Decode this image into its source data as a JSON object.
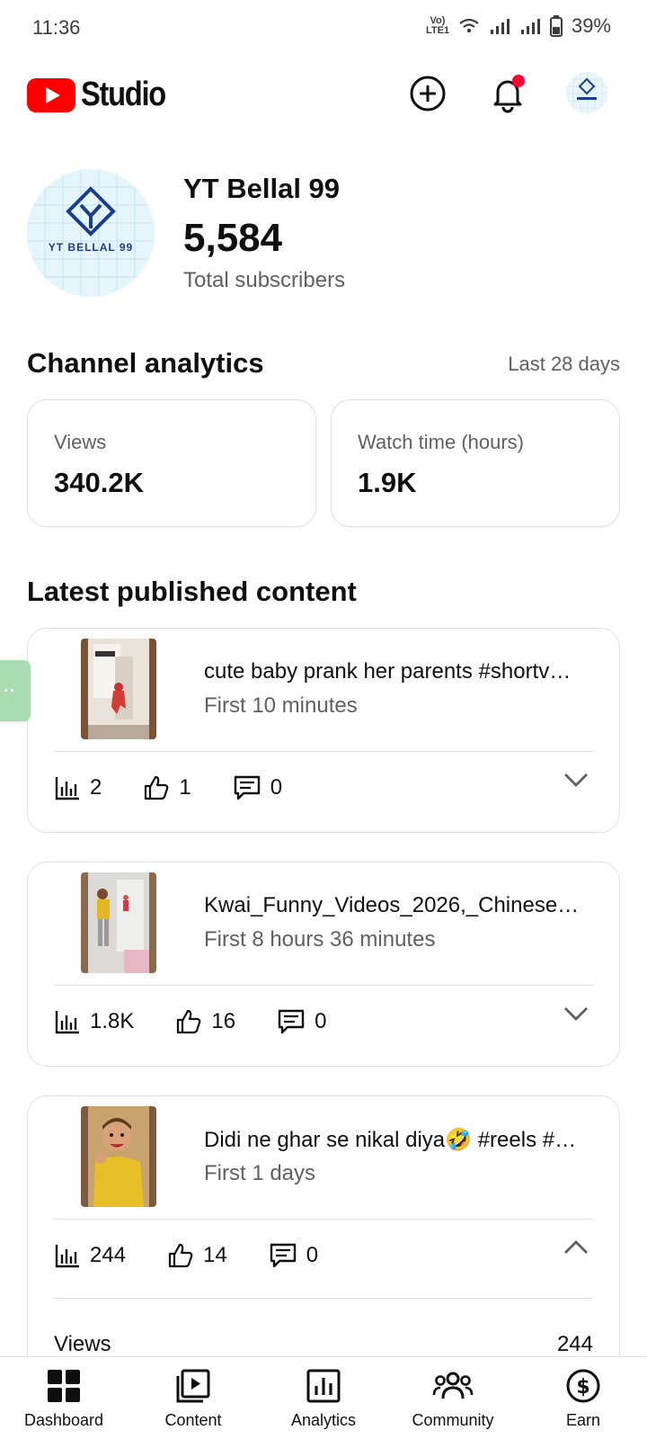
{
  "status_bar": {
    "time": "11:36",
    "network_label": "Vo) LTE1",
    "battery": "39%",
    "icons": [
      "volte-icon",
      "wifi-icon",
      "signal-icon",
      "signal-icon",
      "battery-icon"
    ]
  },
  "header": {
    "logo_text": "Studio",
    "brand_color": "#ff0000",
    "create_icon": "plus-circle-icon",
    "notification_icon": "bell-icon",
    "notification_dot_color": "#ff0033"
  },
  "channel": {
    "avatar_text": "YT BELLAL 99",
    "name": "YT Bellal 99",
    "subscribers": "5,584",
    "subscribers_label": "Total subscribers"
  },
  "analytics": {
    "title": "Channel analytics",
    "period": "Last 28 days",
    "stats": [
      {
        "label": "Views",
        "value": "340.2K"
      },
      {
        "label": "Watch time (hours)",
        "value": "1.9K"
      }
    ]
  },
  "latest": {
    "title": "Latest published content",
    "items": [
      {
        "title": "cute baby prank her parents #shortv…",
        "subtitle": "First 10 minutes",
        "views": "2",
        "likes": "1",
        "comments": "0",
        "expanded": false
      },
      {
        "title": "Kwai_Funny_Videos_2026,_Chinese…",
        "subtitle": "First 8 hours 36 minutes",
        "views": "1.8K",
        "likes": "16",
        "comments": "0",
        "expanded": false
      },
      {
        "title": "Didi ne ghar se nikal diya🤣 #reels #…",
        "subtitle": "First 1 days",
        "views": "244",
        "likes": "14",
        "comments": "0",
        "expanded": true,
        "detail_label": "Views",
        "detail_value": "244"
      }
    ]
  },
  "float_tab": {
    "label": "··"
  },
  "bottom_nav": [
    {
      "label": "Dashboard",
      "icon": "dashboard-icon"
    },
    {
      "label": "Content",
      "icon": "content-icon"
    },
    {
      "label": "Analytics",
      "icon": "analytics-icon"
    },
    {
      "label": "Community",
      "icon": "community-icon"
    },
    {
      "label": "Earn",
      "icon": "earn-icon"
    }
  ]
}
